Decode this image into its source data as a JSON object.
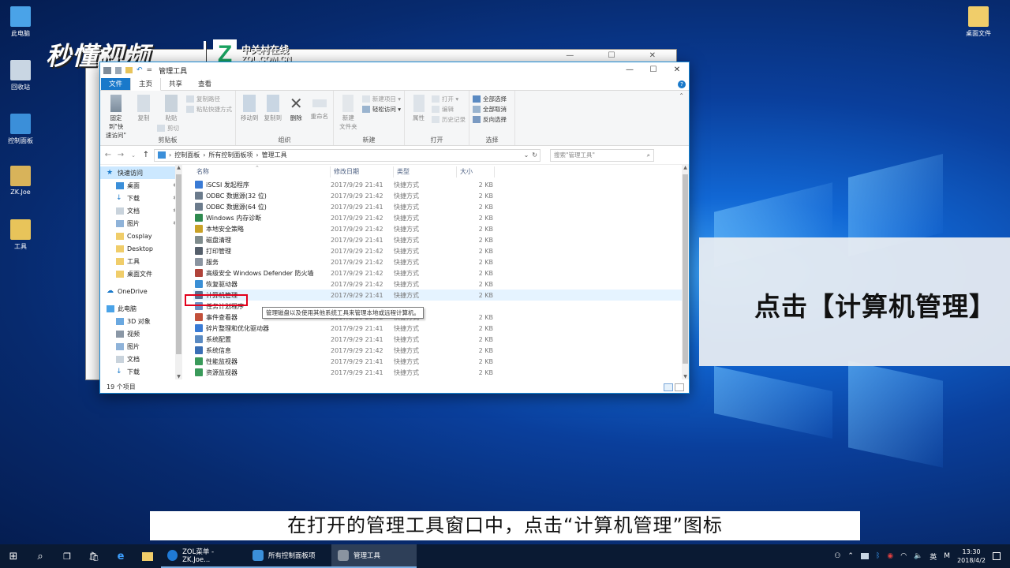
{
  "watermark": {
    "logo": "秒懂视频",
    "brand_letter": "Z",
    "brand_cn": "中关村在线",
    "brand_en": "ZOL.COM.CN"
  },
  "desktop_icons": [
    {
      "label": "此电脑",
      "color": "#4aa3e8"
    },
    {
      "label": "回收站",
      "color": "#c9d6e3"
    },
    {
      "label": "控制面板",
      "color": "#3b8fd9"
    },
    {
      "label": "ZK.Joe",
      "color": "#d8b35a"
    },
    {
      "label": "工具",
      "color": "#e8c45a"
    },
    {
      "label": "桌面文件",
      "color": "#f0cd6a"
    }
  ],
  "window": {
    "title": "管理工具",
    "controls": {
      "min": "—",
      "max": "☐",
      "close": "✕"
    },
    "tabs": [
      "文件",
      "主页",
      "共享",
      "查看"
    ],
    "ribbon": {
      "clipboard": {
        "label": "剪贴板",
        "pin": "固定到\"快\n速访问\"",
        "copy": "复制",
        "paste": "粘贴",
        "copy_path": "复制路径",
        "paste_shortcut": "粘贴快捷方式",
        "cut": "剪切"
      },
      "organize": {
        "label": "组织",
        "move_to": "移动到",
        "copy_to": "复制到",
        "delete": "删除",
        "rename": "重命名"
      },
      "new": {
        "label": "新建",
        "new_folder": "新建\n文件夹",
        "new_item": "新建项目 ▾",
        "easy_access": "轻松访问 ▾"
      },
      "open": {
        "label": "打开",
        "properties": "属性",
        "open": "打开 ▾",
        "edit": "编辑",
        "history": "历史记录"
      },
      "select": {
        "label": "选择",
        "select_all": "全部选择",
        "select_none": "全部取消",
        "invert": "反向选择"
      }
    },
    "address": {
      "path": [
        "控制面板",
        "所有控制面板项",
        "管理工具"
      ],
      "search_placeholder": "搜索\"管理工具\""
    },
    "nav": {
      "quick_access": "快速访问",
      "pinned": [
        "桌面",
        "下载",
        "文档",
        "图片"
      ],
      "folders": [
        "Cosplay",
        "Desktop",
        "工具",
        "桌面文件"
      ],
      "onedrive": "OneDrive",
      "this_pc": "此电脑",
      "pc_items": [
        "3D 对象",
        "视频",
        "图片",
        "文档",
        "下载"
      ]
    },
    "columns": {
      "name": "名称",
      "date": "修改日期",
      "type": "类型",
      "size": "大小"
    },
    "files": [
      {
        "name": "iSCSI 发起程序",
        "date": "2017/9/29 21:41",
        "type": "快捷方式",
        "size": "2 KB",
        "color": "#3a7bd5"
      },
      {
        "name": "ODBC 数据源(32 位)",
        "date": "2017/9/29 21:42",
        "type": "快捷方式",
        "size": "2 KB",
        "color": "#6b7b8c"
      },
      {
        "name": "ODBC 数据源(64 位)",
        "date": "2017/9/29 21:41",
        "type": "快捷方式",
        "size": "2 KB",
        "color": "#6b7b8c"
      },
      {
        "name": "Windows 内存诊断",
        "date": "2017/9/29 21:42",
        "type": "快捷方式",
        "size": "2 KB",
        "color": "#2f8a4f"
      },
      {
        "name": "本地安全策略",
        "date": "2017/9/29 21:42",
        "type": "快捷方式",
        "size": "2 KB",
        "color": "#c9a227"
      },
      {
        "name": "磁盘清理",
        "date": "2017/9/29 21:41",
        "type": "快捷方式",
        "size": "2 KB",
        "color": "#7f8c8d"
      },
      {
        "name": "打印管理",
        "date": "2017/9/29 21:42",
        "type": "快捷方式",
        "size": "2 KB",
        "color": "#555f6b"
      },
      {
        "name": "服务",
        "date": "2017/9/29 21:42",
        "type": "快捷方式",
        "size": "2 KB",
        "color": "#8a94a0"
      },
      {
        "name": "高级安全 Windows Defender 防火墙",
        "date": "2017/9/29 21:42",
        "type": "快捷方式",
        "size": "2 KB",
        "color": "#b0433a"
      },
      {
        "name": "恢复驱动器",
        "date": "2017/9/29 21:42",
        "type": "快捷方式",
        "size": "2 KB",
        "color": "#3a8fd5"
      },
      {
        "name": "计算机管理",
        "date": "2017/9/29 21:41",
        "type": "快捷方式",
        "size": "2 KB",
        "color": "#5a6f8f"
      },
      {
        "name": "任务计划程序",
        "date": "",
        "type": "",
        "size": "",
        "color": "#6b8fc2"
      },
      {
        "name": "事件查看器",
        "date": "2017/9/29 21:42",
        "type": "快捷方式",
        "size": "2 KB",
        "color": "#c2503a"
      },
      {
        "name": "碎片整理和优化驱动器",
        "date": "2017/9/29 21:41",
        "type": "快捷方式",
        "size": "2 KB",
        "color": "#3a7bd5"
      },
      {
        "name": "系统配置",
        "date": "2017/9/29 21:41",
        "type": "快捷方式",
        "size": "2 KB",
        "color": "#5a8ac2"
      },
      {
        "name": "系统信息",
        "date": "2017/9/29 21:42",
        "type": "快捷方式",
        "size": "2 KB",
        "color": "#3a6fb5"
      },
      {
        "name": "性能监视器",
        "date": "2017/9/29 21:41",
        "type": "快捷方式",
        "size": "2 KB",
        "color": "#3a9a5a"
      },
      {
        "name": "资源监视器",
        "date": "2017/9/29 21:41",
        "type": "快捷方式",
        "size": "2 KB",
        "color": "#3a9a5a"
      }
    ],
    "tooltip": "管理磁盘以及使用其他系统工具来管理本地或远程计算机。",
    "status": "19 个项目"
  },
  "overlay": {
    "caption": "点击【计算机管理】",
    "subtitle": "在打开的管理工具窗口中，点击“计算机管理”图标"
  },
  "taskbar": {
    "apps": [
      {
        "label": "ZOL菜单 - ZK.Joe...",
        "color": "#1f7ad6"
      },
      {
        "label": "所有控制面板项",
        "color": "#3b8fd9"
      },
      {
        "label": "管理工具",
        "color": "#8a94a0"
      }
    ],
    "ime": "英",
    "ime_mode": "M",
    "time": "13:30",
    "date": "2018/4/2"
  }
}
